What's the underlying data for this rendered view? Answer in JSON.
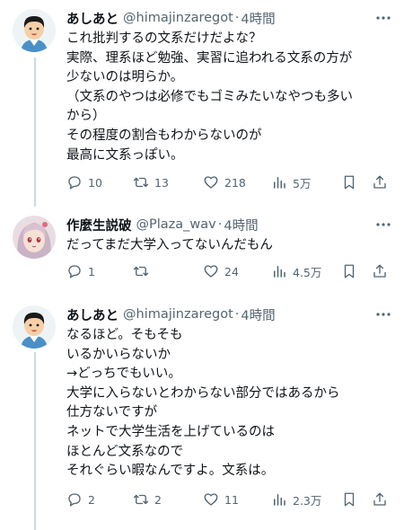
{
  "tweets": [
    {
      "name": "あしあと",
      "handle": "@himajinzaregot",
      "sep": "·",
      "time": "4時間",
      "lines": [
        "これ批判するの文系だけだよな？",
        "実際、理系ほど勉強、実習に追われる文系の方が",
        "少ないのは明らか。",
        "（文系のやつは必修でもゴミみたいなやつも多い",
        "から）",
        "その程度の割合もわからないのが",
        "最高に文系っぽい。"
      ],
      "replies": "10",
      "retweets": "13",
      "likes": "218",
      "views": "5万"
    },
    {
      "name": "作麼生説破",
      "handle": "@Plaza_wav",
      "sep": "·",
      "time": "4時間",
      "lines": [
        "だってまだ大学入ってないんだもん"
      ],
      "replies": "1",
      "retweets": "",
      "likes": "24",
      "views": "4.5万"
    },
    {
      "name": "あしあと",
      "handle": "@himajinzaregot",
      "sep": "·",
      "time": "4時間",
      "lines": [
        "なるほど。そもそも",
        "いるかいらないか",
        "→どっちでもいい。",
        "大学に入らないとわからない部分ではあるから",
        "仕方ないですが",
        "ネットで大学生活を上げているのは",
        "ほとんど文系なので",
        "それぐらい暇なんですよ。文系は。"
      ],
      "replies": "2",
      "retweets": "2",
      "likes": "11",
      "views": "2.3万"
    }
  ],
  "colors": {
    "text": "#0f1419",
    "muted": "#536471",
    "line": "#cfd9de"
  },
  "icons": [
    "reply-icon",
    "retweet-icon",
    "like-icon",
    "views-icon",
    "bookmark-icon",
    "share-icon",
    "more-icon"
  ]
}
